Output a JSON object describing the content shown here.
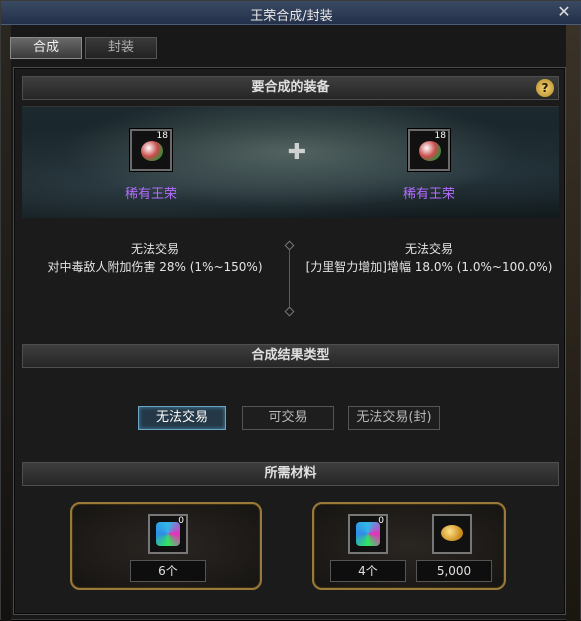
{
  "window": {
    "title": "王荣合成/封装",
    "close_glyph": "✕"
  },
  "tabs": [
    {
      "label": "合成",
      "active": true
    },
    {
      "label": "封装",
      "active": false
    }
  ],
  "section_equipment": {
    "title": "要合成的装备",
    "help": "?"
  },
  "slots": [
    {
      "name": "稀有王荣",
      "badge": "18"
    },
    {
      "name": "稀有王荣",
      "badge": "18"
    }
  ],
  "left_info": {
    "trade": "无法交易",
    "stat": "对中毒敌人附加伤害 28% (1%~150%)"
  },
  "right_info": {
    "trade": "无法交易",
    "stat": "[力里智力增加]增幅 18.0% (1.0%~100.0%)"
  },
  "section_result": {
    "title": "合成结果类型"
  },
  "result_types": [
    {
      "label": "无法交易",
      "active": true
    },
    {
      "label": "可交易",
      "active": false
    },
    {
      "label": "无法交易(封)",
      "active": false
    }
  ],
  "section_materials": {
    "title": "所需材料"
  },
  "materials": {
    "left": {
      "badge": "0",
      "count": "6个"
    },
    "right": {
      "badge": "0",
      "count": "4个",
      "gold": "5,000"
    }
  },
  "icons": {
    "plus": "plus-icon",
    "gem": "rare-emblem-icon",
    "material": "crystal-icon",
    "gold": "gold-coin-icon"
  }
}
